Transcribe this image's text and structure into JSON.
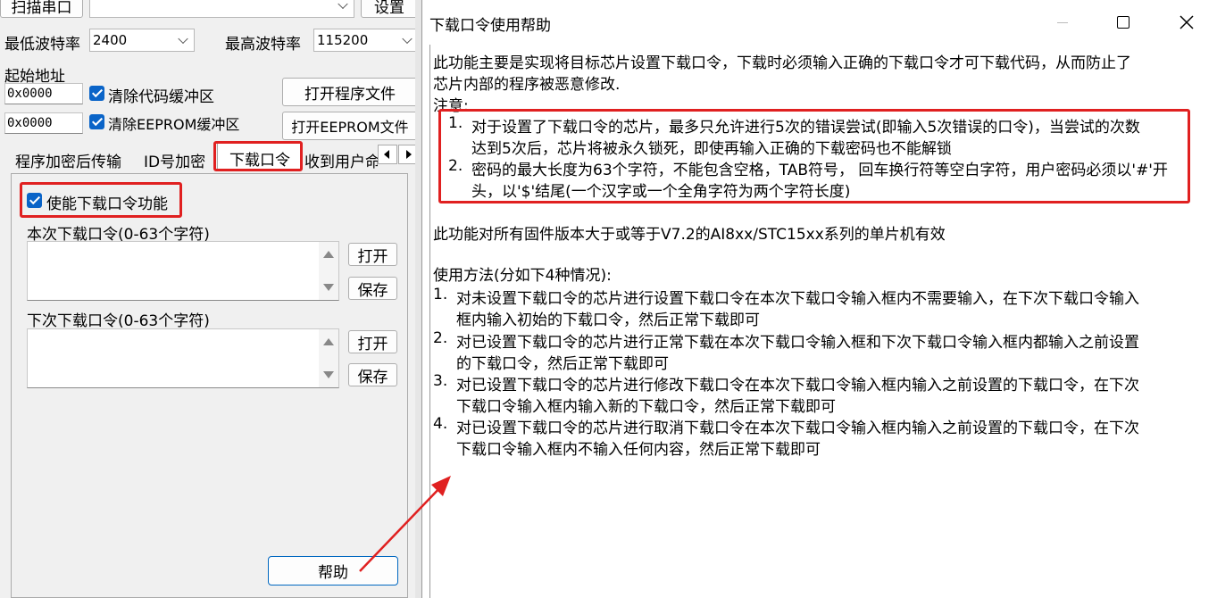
{
  "main": {
    "scan_port_button": "扫描串口",
    "settings_button": "设置",
    "min_baud_label": "最低波特率",
    "min_baud_value": "2400",
    "max_baud_label": "最高波特率",
    "max_baud_value": "115200",
    "start_addr_label": "起始地址",
    "code_addr_value": "0x0000",
    "clear_code_label": "清除代码缓冲区",
    "open_program_button": "打开程序文件",
    "eeprom_addr_value": "0x0000",
    "clear_eeprom_label": "清除EEPROM缓冲区",
    "open_eeprom_button": "打开EEPROM文件"
  },
  "tabs": {
    "items": [
      "程序加密后传输",
      "ID号加密",
      "下载口令",
      "收到用户命"
    ],
    "active": "下载口令"
  },
  "panel": {
    "enable_label": "使能下载口令功能",
    "current_pwd_label": "本次下载口令(0-63个字符)",
    "next_pwd_label": "下次下载口令(0-63个字符)",
    "open_label": "打开",
    "save_label": "保存",
    "help_button": "帮助"
  },
  "dialog": {
    "title": "下载口令使用帮助",
    "intro": [
      "此功能主要是实现将目标芯片设置下载口令，下载时必须输入正确的下载口令才可下载代码，从而防止了",
      "芯片内部的程序被恶意修改."
    ],
    "note_label": "注意:",
    "notes": [
      {
        "num": "1.",
        "lines": [
          "对于设置了下载口令的芯片，最多只允许进行5次的错误尝试(即输入5次错误的口令)，当尝试的次数",
          "达到5次后，芯片将被永久锁死，即使再输入正确的下载密码也不能解锁"
        ]
      },
      {
        "num": "2.",
        "lines": [
          "密码的最大长度为63个字符，不能包含空格，TAB符号， 回车换行符等空白字符，用户密码必须以'#'开",
          "头，以'$'结尾(一个汉字或一个全角字符为两个字符长度)"
        ]
      }
    ],
    "applies": "此功能对所有固件版本大于或等于V7.2的AI8xx/STC15xx系列的单片机有效",
    "usage_label": "使用方法(分如下4种情况):",
    "usage": [
      {
        "num": "1.",
        "lines": [
          "对未设置下载口令的芯片进行设置下载口令在本次下载口令输入框内不需要输入，在下次下载口令输入",
          "框内输入初始的下载口令，然后正常下载即可"
        ]
      },
      {
        "num": "2.",
        "lines": [
          "对已设置下载口令的芯片进行正常下载在本次下载口令输入框和下次下载口令输入框内都输入之前设置",
          "的下载口令，然后正常下载即可"
        ]
      },
      {
        "num": "3.",
        "lines": [
          "对已设置下载口令的芯片进行修改下载口令在本次下载口令输入框内输入之前设置的下载口令，在下次",
          "下载口令输入框内输入新的下载口令，然后正常下载即可"
        ]
      },
      {
        "num": "4.",
        "lines": [
          "对已设置下载口令的芯片进行取消下载口令在本次下载口令输入框内输入之前设置的下载口令，在下次",
          "下载口令输入框内不输入任何内容，然后正常下载即可"
        ]
      }
    ]
  },
  "colors": {
    "highlight": "#e02020",
    "check": "#0a64c8"
  }
}
